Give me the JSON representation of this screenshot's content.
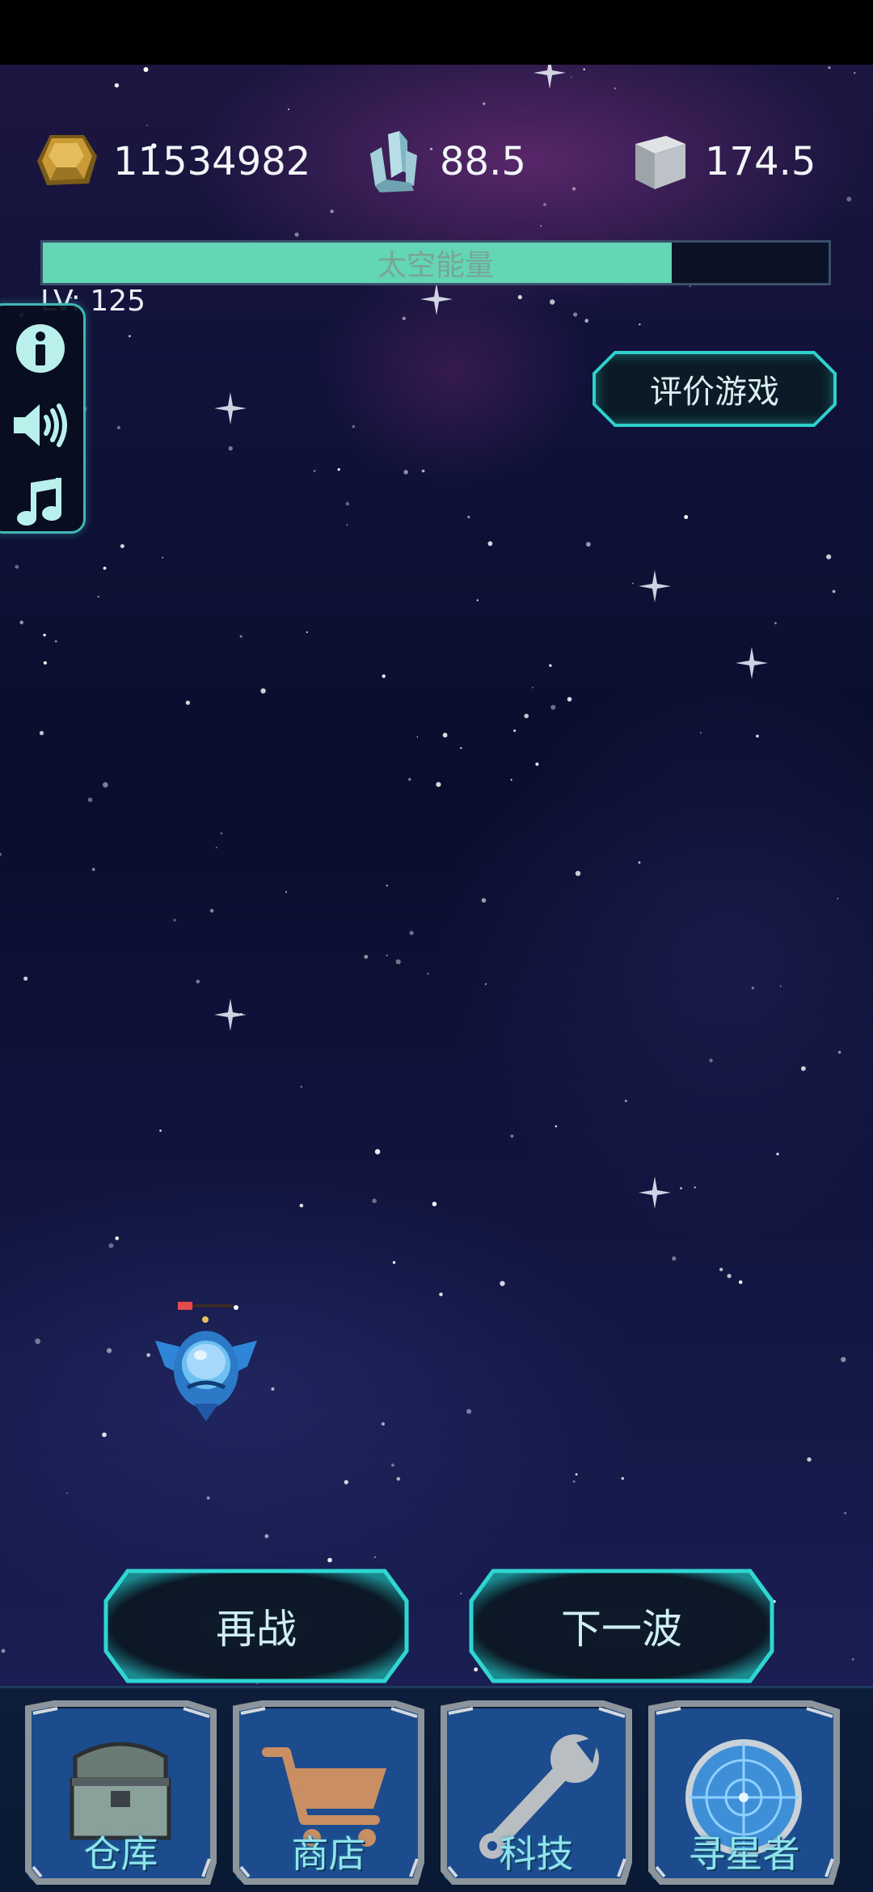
{
  "resources": {
    "gold": {
      "icon": "gold-ore-icon",
      "value": "11534982"
    },
    "crystal": {
      "icon": "crystal-icon",
      "value": "88.5"
    },
    "metal": {
      "icon": "metal-cube-icon",
      "value": "174.5"
    }
  },
  "energy": {
    "label": "太空能量",
    "fill_fraction": 0.8,
    "fill_color": "#62d6b5"
  },
  "level": {
    "text": "LV: 125"
  },
  "side_panel": {
    "info_icon": "info-icon",
    "sound_icon": "speaker-icon",
    "music_icon": "music-note-icon"
  },
  "rate_game": {
    "label": "评价游戏"
  },
  "actions": {
    "retry_label": "再战",
    "next_wave_label": "下一波"
  },
  "nav": {
    "items": [
      {
        "label": "仓库",
        "icon": "treasure-chest-icon"
      },
      {
        "label": "商店",
        "icon": "shopping-cart-icon"
      },
      {
        "label": "科技",
        "icon": "wrench-icon"
      },
      {
        "label": "寻星者",
        "icon": "radar-icon"
      }
    ]
  },
  "colors": {
    "accent_cyan": "#2fd0cc",
    "energy_green": "#62d6b5",
    "nav_text": "#8ee4ee"
  }
}
